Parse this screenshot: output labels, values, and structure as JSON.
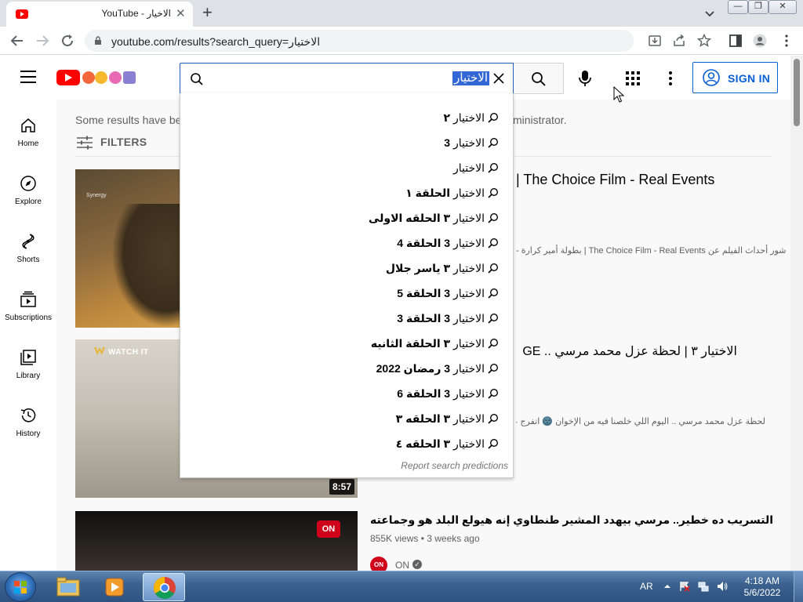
{
  "browser": {
    "tab": {
      "title": "YouTube - الاخيار"
    },
    "url": "youtube.com/results?search_query=الاختيار"
  },
  "youtube": {
    "search": {
      "query": "الاختيار"
    },
    "sign_in": "SIGN IN",
    "guide": [
      {
        "label": "Home",
        "icon": "home-icon"
      },
      {
        "label": "Explore",
        "icon": "compass-icon"
      },
      {
        "label": "Shorts",
        "icon": "shorts-icon"
      },
      {
        "label": "Subscriptions",
        "icon": "subscriptions-icon"
      },
      {
        "label": "Library",
        "icon": "library-icon"
      },
      {
        "label": "History",
        "icon": "history-icon"
      }
    ],
    "notice_start": "Some results have be",
    "notice_end": "ministrator.",
    "filters_label": "FILTERS",
    "suggestions": [
      {
        "prefix": "الاختيار",
        "suffix": " ٢"
      },
      {
        "prefix": "الاختيار",
        "suffix": " 3"
      },
      {
        "prefix": "الاختيار",
        "suffix": ""
      },
      {
        "prefix": "الاختيار",
        "suffix": " الحلقة ١"
      },
      {
        "prefix": "الاختيار",
        "suffix": " ٣ الحلقه الاولى"
      },
      {
        "prefix": "الاختيار",
        "suffix": " 3 الحلقة 4"
      },
      {
        "prefix": "الاختيار",
        "suffix": " ٣ ياسر جلال"
      },
      {
        "prefix": "الاختيار",
        "suffix": " 3 الحلقة 5"
      },
      {
        "prefix": "الاختيار",
        "suffix": " 3 الحلقة 3"
      },
      {
        "prefix": "الاختيار",
        "suffix": " ٣ الحلقة الثانيه"
      },
      {
        "prefix": "الاختيار",
        "suffix": " 3 رمضان 2022"
      },
      {
        "prefix": "الاختيار",
        "suffix": " 3 الحلقة 6"
      },
      {
        "prefix": "الاختيار",
        "suffix": " ٣ الحلقه ٣"
      },
      {
        "prefix": "الاختيار",
        "suffix": " ٣ الحلقه ٤"
      }
    ],
    "report_predictions": "Report search predictions",
    "results": [
      {
        "title_visible": "| The Choice Film - Real Events",
        "desc_visible": "- بطولة أمير كرارة | The Choice Film - Real Events شور أحداث الفيلم عن",
        "thumb_text": "Synergy"
      },
      {
        "title_visible": "الاختيار ٣ | لحظة عزل محمد مرسي ..  GE",
        "desc_visible": "لحظة عزل محمد مرسي .. اليوم اللي خلصنا فيه من الإخوان 🌚 اتفرج على مسلسل",
        "duration": "8:57",
        "thumb_badge": "WATCH IT"
      },
      {
        "title": "التسريب ده خطير.. مرسي بيهدد المشير طنطاوي إنه هيولع البلد هو وجماعته",
        "views": "855K views",
        "age": "3 weeks ago",
        "channel": "ON",
        "thumb_badge": "ON"
      }
    ]
  },
  "taskbar": {
    "language": "AR",
    "time": "4:18 AM",
    "date": "5/6/2022"
  },
  "colors": {
    "youtube_red": "#ff0000",
    "link_blue": "#065fd4",
    "focus_blue": "#1c62b9",
    "selection": "#3367d6"
  }
}
